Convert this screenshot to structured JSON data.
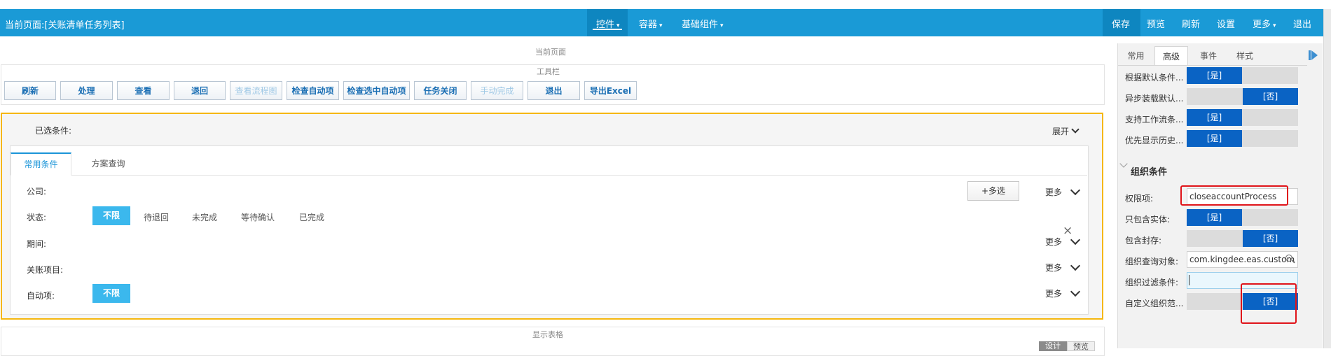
{
  "header": {
    "current_page": "当前页面:[关账清单任务列表]",
    "menus": [
      {
        "label": "控件",
        "caret": "▾"
      },
      {
        "label": "容器",
        "caret": "▾"
      },
      {
        "label": "基础组件",
        "caret": "▾"
      }
    ],
    "actions": {
      "save": "保存",
      "preview": "预览",
      "refresh": "刷新",
      "settings": "设置",
      "more": "更多",
      "more_caret": "▾",
      "exit": "退出"
    }
  },
  "canvas": {
    "title": "当前页面",
    "toolbar_title": "工具栏",
    "toolbar_buttons": [
      {
        "label": "刷新",
        "enabled": true
      },
      {
        "label": "处理",
        "enabled": true
      },
      {
        "label": "查看",
        "enabled": true
      },
      {
        "label": "退回",
        "enabled": true
      },
      {
        "label": "查看流程图",
        "enabled": false
      },
      {
        "label": "检查自动项",
        "enabled": true
      },
      {
        "label": "检查选中自动项",
        "enabled": true
      },
      {
        "label": "任务关闭",
        "enabled": true
      },
      {
        "label": "手动完成",
        "enabled": false
      },
      {
        "label": "退出",
        "enabled": true
      },
      {
        "label": "导出Excel",
        "enabled": true
      }
    ],
    "filter": {
      "selected_label": "已选条件:",
      "expand_label": "展开",
      "tabs": [
        "常用条件",
        "方案查询"
      ],
      "multi_select_label": "+多选",
      "more_label": "更多",
      "close_icon": "×",
      "rows": [
        {
          "label": "公司:"
        },
        {
          "label": "状态:",
          "options": [
            "不限",
            "待退回",
            "未完成",
            "等待确认",
            "已完成"
          ],
          "active_option": "不限"
        },
        {
          "label": "期间:"
        },
        {
          "label": "关账项目:"
        },
        {
          "label": "自动项:",
          "options": [
            "不限"
          ],
          "active_option": "不限"
        }
      ]
    },
    "grid": {
      "title": "显示表格",
      "mode_design": "设计",
      "mode_preview": "预览"
    }
  },
  "properties_panel": {
    "tabs": [
      "常用",
      "高级",
      "事件",
      "样式"
    ],
    "active_tab": "高级",
    "toggles_top": [
      {
        "label": "根据默认条件...",
        "value": "[是]"
      },
      {
        "label": "异步装载默认...",
        "value": "[否]"
      },
      {
        "label": "支持工作流条...",
        "value": "[是]"
      },
      {
        "label": "优先显示历史...",
        "value": "[是]"
      }
    ],
    "section_title": "组织条件",
    "org_fields": {
      "permission_label": "权限项:",
      "permission_value": "closeaccountProcess",
      "entity_only_label": "只包含实体:",
      "entity_only_value": "[是]",
      "include_sealed_label": "包含封存:",
      "include_sealed_value": "[否]",
      "query_object_label": "组织查询对象:",
      "query_object_value": "com.kingdee.eas.custom",
      "filter_label": "组织过滤条件:",
      "filter_value": "",
      "custom_range_label": "自定义组织范...",
      "custom_range_value": "[否]"
    }
  },
  "colors": {
    "header_bg": "#1a9ad6",
    "header_active": "#0e86c0",
    "toggle_on": "#0a63c4",
    "option_active": "#3bb8ed",
    "filter_border": "#f5b70f",
    "highlight_red": "#e0141a"
  }
}
